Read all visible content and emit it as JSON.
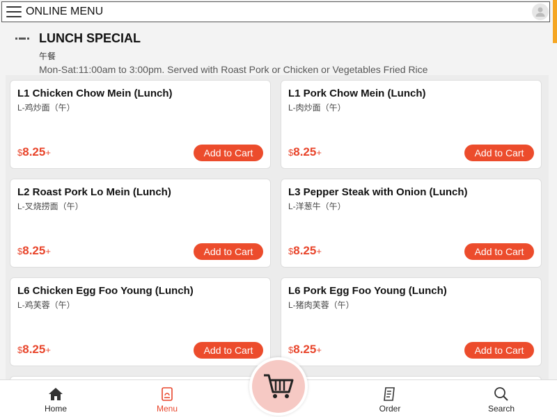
{
  "header": {
    "title": "ONLINE MENU"
  },
  "section": {
    "title": "LUNCH SPECIAL",
    "subtitle": "午餐",
    "description": "Mon-Sat:11:00am to 3:00pm. Served with Roast Pork or Chicken or Vegetables Fried Rice"
  },
  "items": [
    {
      "name": "L1 Chicken Chow Mein (Lunch)",
      "sub": "L-鸡炒面（午）",
      "currency": "$",
      "price": "8.25",
      "plus": "+",
      "button": "Add to Cart"
    },
    {
      "name": "L1 Pork Chow Mein (Lunch)",
      "sub": "L-肉炒面（午）",
      "currency": "$",
      "price": "8.25",
      "plus": "+",
      "button": "Add to Cart"
    },
    {
      "name": "L2 Roast Pork Lo Mein (Lunch)",
      "sub": "L-叉烧捞面（午）",
      "currency": "$",
      "price": "8.25",
      "plus": "+",
      "button": "Add to Cart"
    },
    {
      "name": "L3 Pepper Steak with Onion (Lunch)",
      "sub": "L-洋葱牛（午）",
      "currency": "$",
      "price": "8.25",
      "plus": "+",
      "button": "Add to Cart"
    },
    {
      "name": "L6 Chicken Egg Foo Young (Lunch)",
      "sub": "L-鸡芙蓉（午）",
      "currency": "$",
      "price": "8.25",
      "plus": "+",
      "button": "Add to Cart"
    },
    {
      "name": "L6 Pork Egg Foo Young (Lunch)",
      "sub": "L-猪肉芙蓉（午）",
      "currency": "$",
      "price": "8.25",
      "plus": "+",
      "button": "Add to Cart"
    }
  ],
  "nav": {
    "home": "Home",
    "menu": "Menu",
    "order": "Order",
    "search": "Search"
  },
  "colors": {
    "accent": "#ec4c2c",
    "price": "#e8442a",
    "scroll_accent": "#f5a623"
  },
  "icons": [
    "menu-icon",
    "user-icon",
    "home-icon",
    "menu-book-icon",
    "cart-icon",
    "order-icon",
    "search-icon"
  ]
}
